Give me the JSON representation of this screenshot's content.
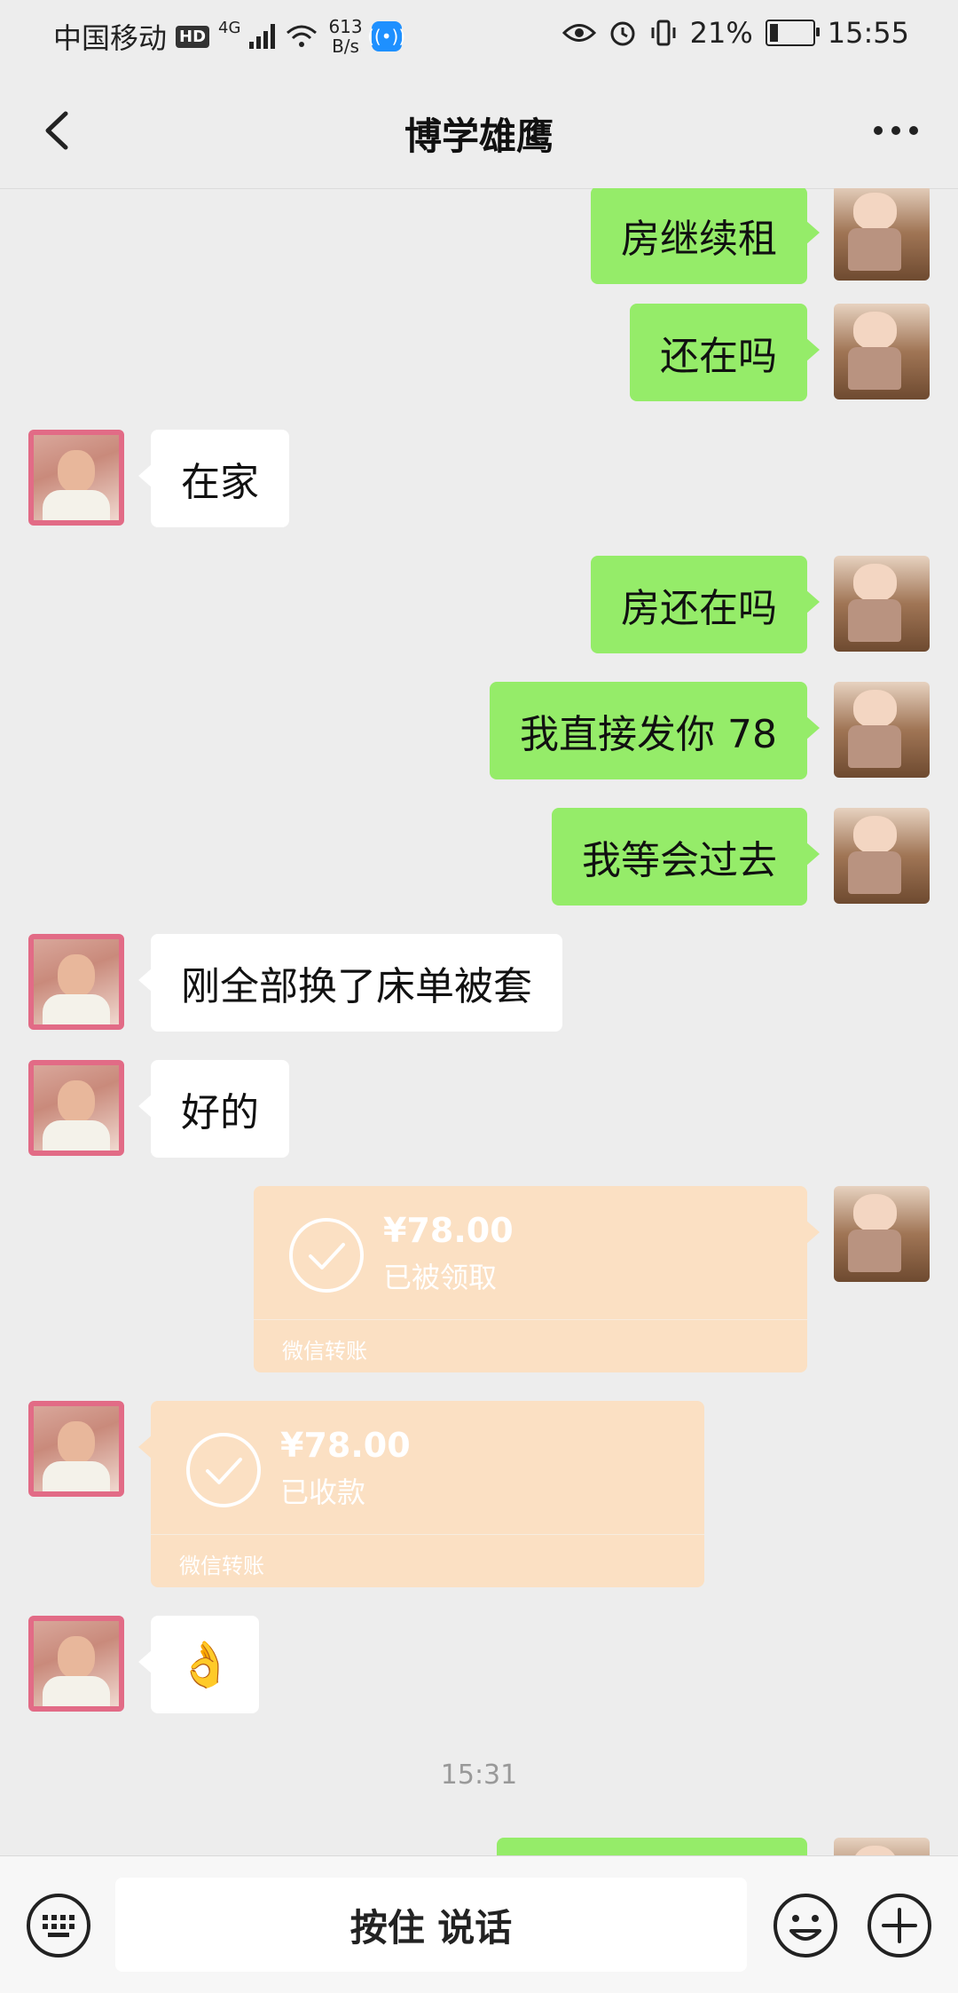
{
  "status_bar": {
    "carrier": "中国移动",
    "hd": "HD",
    "network": "4G",
    "speed_value": "613",
    "speed_unit": "B/s",
    "battery": "21%",
    "battery_level": 0.21,
    "time": "15:55"
  },
  "header": {
    "title": "博学雄鹰"
  },
  "messages": [
    {
      "side": "self",
      "type": "text",
      "text": "房继续租"
    },
    {
      "side": "self",
      "type": "text",
      "text": "还在吗"
    },
    {
      "side": "other",
      "type": "text",
      "text": "在家"
    },
    {
      "side": "self",
      "type": "text",
      "text": "房还在吗"
    },
    {
      "side": "self",
      "type": "text",
      "text": "我直接发你 78"
    },
    {
      "side": "self",
      "type": "text",
      "text": "我等会过去"
    },
    {
      "side": "other",
      "type": "text",
      "text": "刚全部换了床单被套"
    },
    {
      "side": "other",
      "type": "text",
      "text": "好的"
    },
    {
      "side": "self",
      "type": "transfer",
      "amount": "¥78.00",
      "status": "已被领取",
      "caption": "微信转账"
    },
    {
      "side": "other",
      "type": "transfer",
      "amount": "¥78.00",
      "status": "已收款",
      "caption": "微信转账"
    },
    {
      "side": "other",
      "type": "emoji",
      "emoji": "👌"
    }
  ],
  "timestamp": "15:31",
  "input_bar": {
    "voice_label": "按住 说话"
  },
  "colors": {
    "self_bubble": "#95ec69",
    "other_bubble": "#ffffff",
    "transfer": "#fbe0c3",
    "background": "#ededed"
  }
}
